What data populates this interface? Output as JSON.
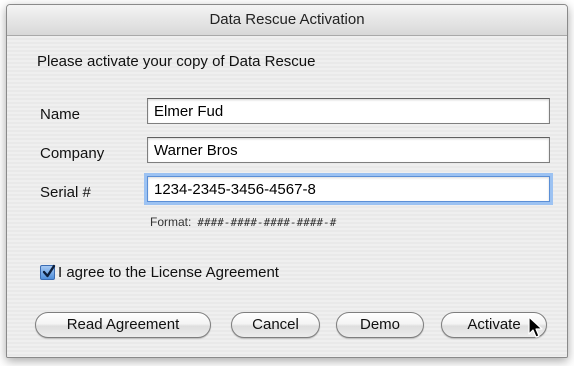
{
  "window": {
    "title": "Data Rescue Activation"
  },
  "prompt": "Please activate your copy of Data Rescue",
  "form": {
    "name": {
      "label": "Name",
      "value": "Elmer Fud"
    },
    "company": {
      "label": "Company",
      "value": "Warner Bros"
    },
    "serial": {
      "label": "Serial #",
      "value": "1234-2345-3456-4567-8"
    },
    "format_label": "Format:",
    "format_pattern": "####-####-####-####-#"
  },
  "agreement": {
    "label": "I agree to the License Agreement",
    "checked": true
  },
  "buttons": {
    "read_agreement": "Read Agreement",
    "cancel": "Cancel",
    "demo": "Demo",
    "activate": "Activate"
  },
  "icons": {
    "checkbox": "checkmark-icon",
    "cursor": "mouse-pointer-icon"
  },
  "colors": {
    "focus_ring": "#9cc2f2",
    "checkbox_fill": "#4f8fdc"
  }
}
